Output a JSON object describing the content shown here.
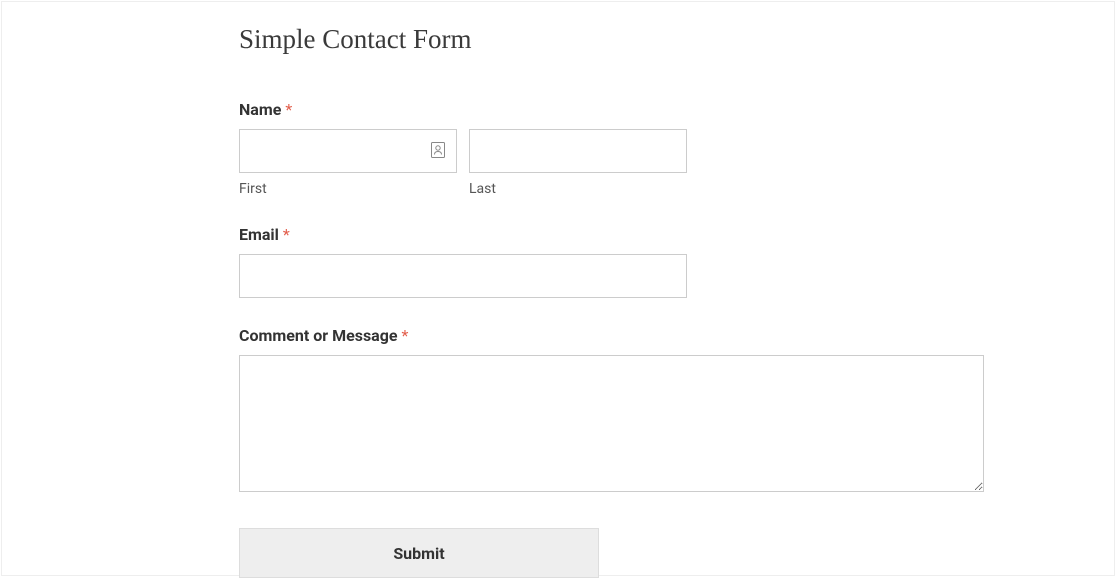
{
  "form": {
    "title": "Simple Contact Form",
    "fields": {
      "name": {
        "label": "Name",
        "required_mark": "*",
        "first_sublabel": "First",
        "last_sublabel": "Last",
        "first_value": "",
        "last_value": ""
      },
      "email": {
        "label": "Email",
        "required_mark": "*",
        "value": ""
      },
      "message": {
        "label": "Comment or Message",
        "required_mark": "*",
        "value": ""
      }
    },
    "submit_label": "Submit"
  }
}
